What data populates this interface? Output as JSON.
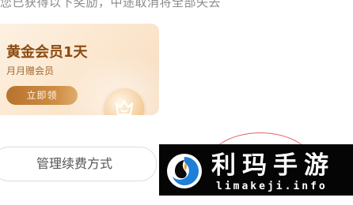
{
  "header": {
    "notice_text": "您已获得以下奖励，中途取消将全部失去"
  },
  "reward_card": {
    "title": "黄金会员1天",
    "subtitle": "月月赠会员",
    "claim_label": "立即领",
    "icon": "crown-badge-icon"
  },
  "actions": {
    "manage_label": "管理续费方式"
  },
  "watermark": {
    "title": "利玛手游",
    "url": "limakeji.info"
  },
  "colors": {
    "card_title": "#8a4b12",
    "claim_button": "#c58438",
    "watermark_bg": "#050505",
    "arc": "#e4605f"
  }
}
